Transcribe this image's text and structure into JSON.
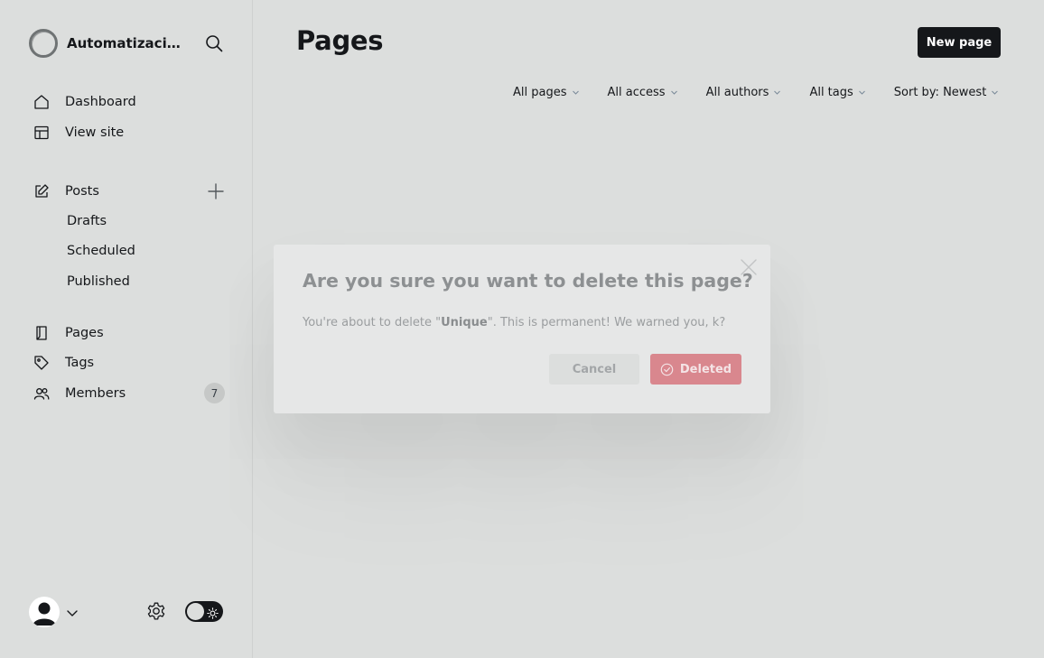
{
  "sidebar": {
    "brand_name": "Automatizacion...",
    "nav_main": [
      {
        "label": "Dashboard",
        "icon": "home-icon"
      },
      {
        "label": "View site",
        "icon": "layout-icon"
      }
    ],
    "posts": {
      "label": "Posts",
      "icon": "edit-icon",
      "sub": [
        "Drafts",
        "Scheduled",
        "Published"
      ]
    },
    "nav_secondary": [
      {
        "label": "Pages",
        "icon": "page-icon"
      },
      {
        "label": "Tags",
        "icon": "tag-icon"
      },
      {
        "label": "Members",
        "icon": "members-icon",
        "count": "7"
      }
    ]
  },
  "main": {
    "title": "Pages",
    "new_button": "New page",
    "filters": [
      "All pages",
      "All access",
      "All authors",
      "All tags",
      "Sort by: Newest"
    ]
  },
  "modal": {
    "title": "Are you sure you want to delete this page?",
    "body_prefix": "You're about to delete \"",
    "body_name": "Unique",
    "body_suffix": "\". This is permanent! We warned you, k?",
    "cancel": "Cancel",
    "confirm": "Deleted"
  },
  "colors": {
    "background": "#dcdedd",
    "primary_dark": "#15171a",
    "danger_faded": "#d9878e"
  }
}
